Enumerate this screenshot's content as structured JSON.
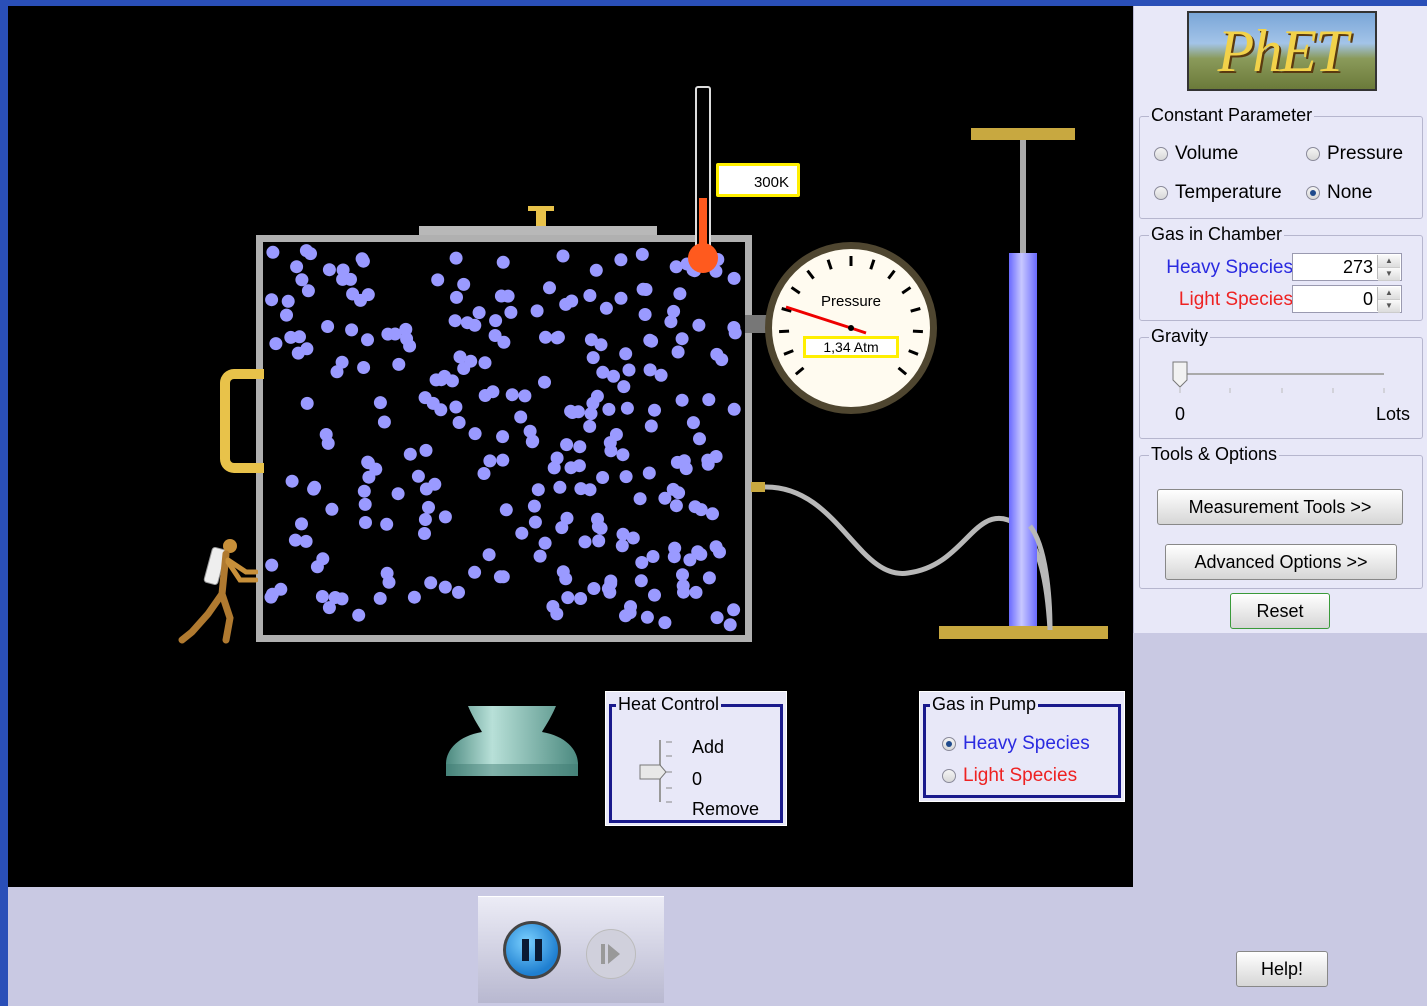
{
  "simulation": {
    "thermometer": {
      "reading": "300K",
      "level": 0.34
    },
    "pressure_gauge": {
      "label": "Pressure",
      "reading": "1,34 Atm"
    },
    "heat_control": {
      "title": "Heat Control",
      "add_label": "Add",
      "zero_label": "0",
      "remove_label": "Remove",
      "value": 0
    },
    "gas_in_pump": {
      "title": "Gas in Pump",
      "options": [
        {
          "label": "Heavy Species",
          "selected": true,
          "color": "#2a2ae0"
        },
        {
          "label": "Light Species",
          "selected": false,
          "color": "#ee2222"
        }
      ]
    },
    "molecule_color": "#9a9aff",
    "heavy_molecule_count": 273
  },
  "control_panel": {
    "logo_text": "PhET",
    "constant_parameter": {
      "title": "Constant Parameter",
      "options": [
        {
          "label": "Volume",
          "selected": false
        },
        {
          "label": "Pressure",
          "selected": false
        },
        {
          "label": "Temperature",
          "selected": false
        },
        {
          "label": "None",
          "selected": true
        }
      ]
    },
    "gas_in_chamber": {
      "title": "Gas in Chamber",
      "heavy": {
        "label": "Heavy Species",
        "value": "273",
        "color": "#2a2ae0"
      },
      "light": {
        "label": "Light Species",
        "value": "0",
        "color": "#ee2222"
      }
    },
    "gravity": {
      "title": "Gravity",
      "min_label": "0",
      "max_label": "Lots",
      "value": 0
    },
    "tools_options": {
      "title": "Tools & Options",
      "measurement_button": "Measurement Tools >>",
      "advanced_button": "Advanced Options >>"
    },
    "reset_button": "Reset"
  },
  "bottom_bar": {
    "help_button": "Help!"
  }
}
